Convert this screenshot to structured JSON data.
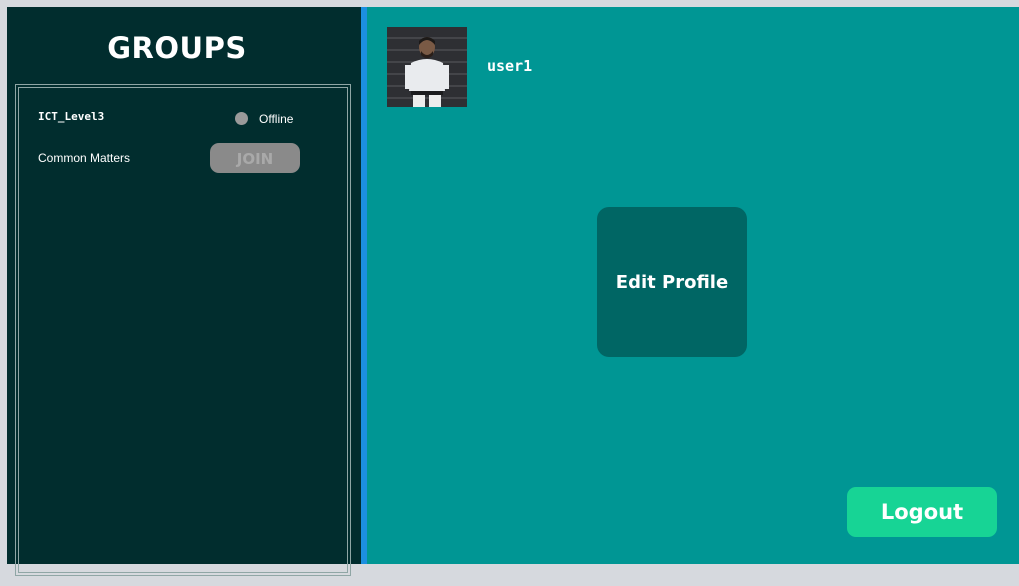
{
  "sidebar": {
    "title": "GROUPS",
    "groups": [
      {
        "name": "ICT_Level3",
        "status": "Offline",
        "status_color": "#9a9a9a"
      },
      {
        "name": "Common Matters",
        "action_label": "JOIN"
      }
    ]
  },
  "profile": {
    "username": "user1",
    "avatar_icon": "user-photo"
  },
  "main": {
    "edit_profile_label": "Edit Profile",
    "logout_label": "Logout"
  },
  "colors": {
    "sidebar_bg": "#012d2e",
    "main_bg": "#009694",
    "divider": "#1c8fe0",
    "edit_profile_bg": "#006664",
    "logout_bg": "#17d495"
  }
}
